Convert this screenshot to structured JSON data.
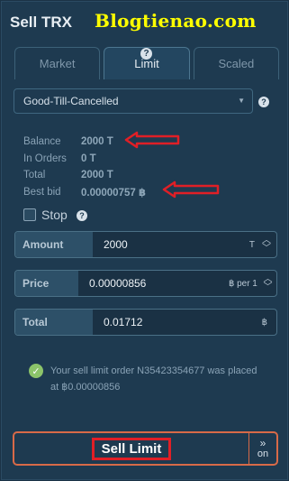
{
  "header": {
    "title": "Sell TRX",
    "watermark": "Blogtienao.com"
  },
  "tabs": [
    {
      "label": "Market",
      "active": false
    },
    {
      "label": "Limit",
      "active": true
    },
    {
      "label": "Scaled",
      "active": false
    }
  ],
  "tabs_help_icon": "?",
  "order_type": {
    "selected": "Good-Till-Cancelled",
    "help_icon": "?"
  },
  "info": {
    "balance_label": "Balance",
    "balance_value": "2000 T",
    "in_orders_label": "In Orders",
    "in_orders_value": "0 T",
    "total_label": "Total",
    "total_value": "2000 T",
    "best_bid_label": "Best bid",
    "best_bid_value": "0.00000757 ฿"
  },
  "stop": {
    "label": "Stop",
    "checked": false,
    "help_icon": "?"
  },
  "amount": {
    "label": "Amount",
    "value": "2000",
    "unit": "T"
  },
  "price": {
    "label": "Price",
    "value": "0.00000856",
    "unit": "฿ per 1"
  },
  "total": {
    "label": "Total",
    "value": "0.01712",
    "unit": "฿"
  },
  "notice": {
    "text": "Your sell limit order N35423354677 was placed at ฿0.00000856"
  },
  "sell_button": {
    "label": "Sell  Limit"
  },
  "toggle": {
    "chevrons": "»",
    "label": "on"
  },
  "colors": {
    "background": "#1e3a50",
    "accent_red": "#e01f26",
    "sell_border": "#d86a48",
    "success": "#8cc46a",
    "watermark": "#ffff00"
  }
}
